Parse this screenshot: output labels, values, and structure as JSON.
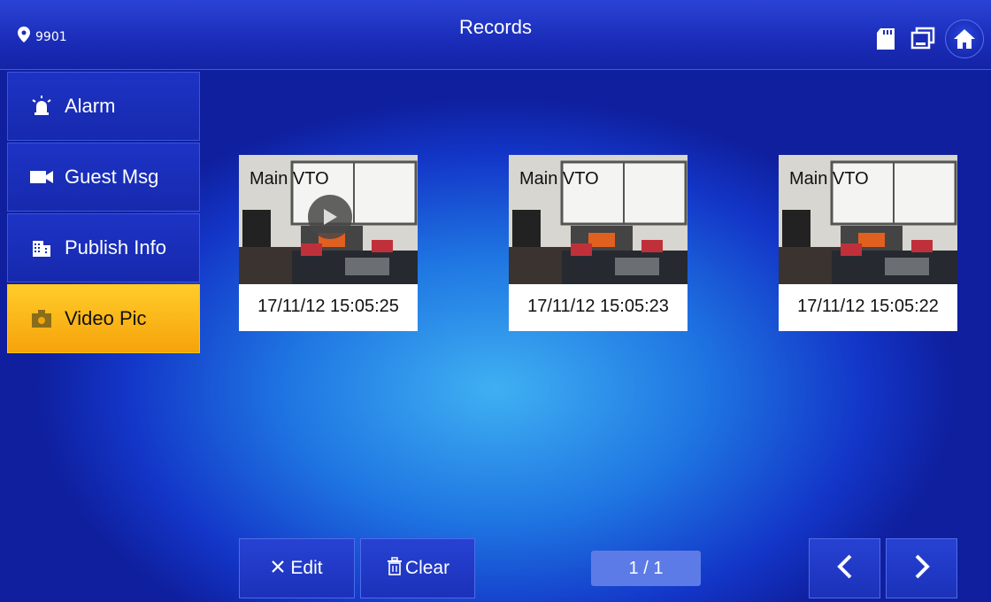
{
  "header": {
    "location_number": "9901",
    "title": "Records",
    "icons": [
      "location-pin-icon",
      "sd-card-icon",
      "monitor-icon",
      "home-icon"
    ]
  },
  "sidebar": {
    "items": [
      {
        "label": "Alarm",
        "icon": "alarm-icon",
        "active": false
      },
      {
        "label": "Guest Msg",
        "icon": "video-camera-icon",
        "active": false
      },
      {
        "label": "Publish Info",
        "icon": "building-icon",
        "active": false
      },
      {
        "label": "Video Pic",
        "icon": "camera-bag-icon",
        "active": true
      }
    ]
  },
  "records": [
    {
      "source": "Main VTO",
      "timestamp": "17/11/12 15:05:25",
      "has_play": true
    },
    {
      "source": "Main VTO",
      "timestamp": "17/11/12 15:05:23",
      "has_play": false
    },
    {
      "source": "Main VTO",
      "timestamp": "17/11/12 15:05:22",
      "has_play": false
    }
  ],
  "toolbar": {
    "edit_label": "Edit",
    "clear_label": "Clear",
    "page_indicator": "1 / 1"
  },
  "colors": {
    "active_tab": "#f6a30a",
    "panel_blue": "#1a2cb8",
    "background_center": "#3fb0f2"
  }
}
